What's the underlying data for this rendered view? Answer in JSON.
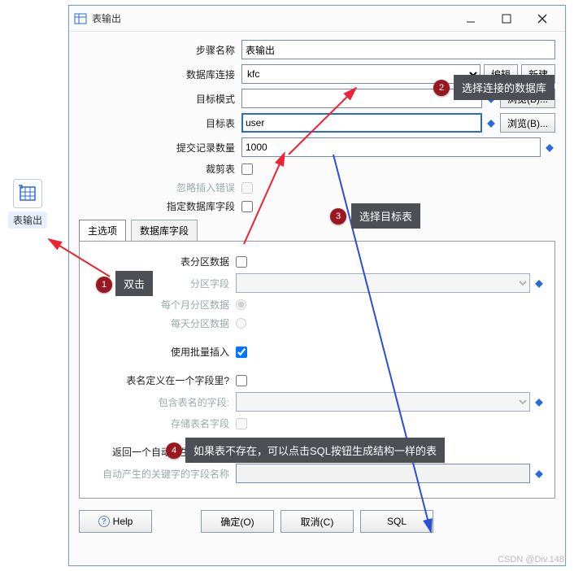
{
  "palette": {
    "label": "表输出"
  },
  "dialog": {
    "title": "表输出",
    "fields": {
      "step_name": {
        "label": "步骤名称",
        "value": "表输出"
      },
      "db_conn": {
        "label": "数据库连接",
        "value": "kfc",
        "btn_edit": "编辑",
        "btn_new": "新建"
      },
      "schema": {
        "label": "目标模式",
        "value": "",
        "browse": "浏览(B)..."
      },
      "table": {
        "label": "目标表",
        "value": "user",
        "browse": "浏览(B)..."
      },
      "commit": {
        "label": "提交记录数量",
        "value": "1000"
      },
      "truncate": {
        "label": "裁剪表"
      },
      "ignore_err": {
        "label": "忽略插入错误"
      },
      "spec_db_fields": {
        "label": "指定数据库字段"
      }
    },
    "tabs": {
      "main": "主选项",
      "dbfields": "数据库字段"
    },
    "panel": {
      "partition": {
        "label": "表分区数据"
      },
      "part_field": {
        "label": "分区字段"
      },
      "monthly": {
        "label": "每个月分区数据"
      },
      "daily": {
        "label": "每天分区数据"
      },
      "batch": {
        "label": "使用批量插入"
      },
      "table_in_field": {
        "label": "表名定义在一个字段里?"
      },
      "table_field": {
        "label": "包含表名的字段:"
      },
      "store_table_field": {
        "label": "存储表名字段"
      },
      "return_key": {
        "label": "返回一个自动产生的关键字"
      },
      "key_field": {
        "label": "自动产生的关键字的字段名称"
      }
    },
    "actions": {
      "help": "Help",
      "ok": "确定(O)",
      "cancel": "取消(C)",
      "sql": "SQL"
    }
  },
  "callouts": {
    "c1": "双击",
    "c2": "选择连接的数据库",
    "c3": "选择目标表",
    "c4": "如果表不存在，可以点击SQL按钮生成结构一样的表"
  },
  "watermark": "CSDN @Div.148"
}
